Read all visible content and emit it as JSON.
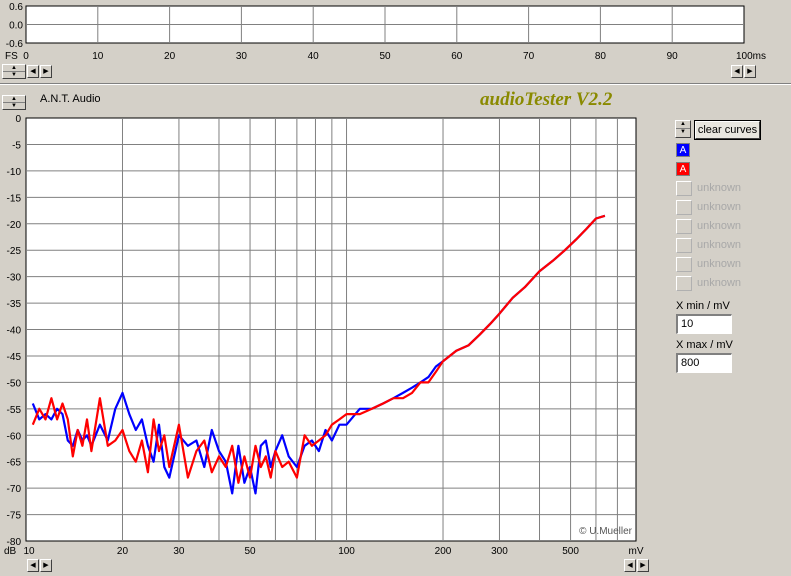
{
  "app": {
    "title": "audioTester V2.2",
    "device": "A.N.T. Audio"
  },
  "top_scope": {
    "y_ticks": [
      "0.6",
      "0.0",
      "-0.6"
    ],
    "x_prefix": "FS",
    "x_ticks": [
      "0",
      "10",
      "20",
      "30",
      "40",
      "50",
      "60",
      "70",
      "80",
      "90",
      "100ms"
    ]
  },
  "controls": {
    "clear_curves": "clear curves",
    "xmin_label": "X min / mV",
    "xmin_value": "10",
    "xmax_label": "X max / mV",
    "xmax_value": "800"
  },
  "legend": [
    {
      "label": "A",
      "color": "#0000ff",
      "active": true
    },
    {
      "label": "A",
      "color": "#ff0000",
      "active": true
    },
    {
      "label": "unknown",
      "active": false
    },
    {
      "label": "unknown",
      "active": false
    },
    {
      "label": "unknown",
      "active": false
    },
    {
      "label": "unknown",
      "active": false
    },
    {
      "label": "unknown",
      "active": false
    },
    {
      "label": "unknown",
      "active": false
    }
  ],
  "colors": {
    "background": "#d4d0c8",
    "plot_bg": "#ffffff",
    "grid": "#808080",
    "brand": "#8a8a00",
    "series_blue": "#0000ff",
    "series_red": "#ff0000"
  },
  "chart_data": {
    "type": "line",
    "xscale": "log",
    "xlim": [
      10,
      800
    ],
    "ylim": [
      -80,
      0
    ],
    "x_unit": "mV",
    "y_unit": "dB",
    "y_ticks": [
      0,
      -5,
      -10,
      -15,
      -20,
      -25,
      -30,
      -35,
      -40,
      -45,
      -50,
      -55,
      -60,
      -65,
      -70,
      -75,
      -80
    ],
    "x_tick_labels": [
      "10",
      "20",
      "30",
      "50",
      "100",
      "200",
      "300",
      "500"
    ],
    "x_tick_values": [
      10,
      20,
      30,
      50,
      100,
      200,
      300,
      500
    ],
    "y_tick_prefix": "dB",
    "copyright": "© U.Mueller",
    "grid": true,
    "series": [
      {
        "color": "#0000ff",
        "x": [
          10.5,
          11,
          11.5,
          12,
          12.5,
          13,
          13.5,
          14,
          14.5,
          15,
          15.5,
          16,
          17,
          18,
          19,
          20,
          21,
          22,
          23,
          24,
          25,
          26,
          27,
          28,
          30,
          32,
          34,
          36,
          38,
          40,
          42,
          44,
          46,
          48,
          50,
          52,
          54,
          56,
          58,
          60,
          63,
          66,
          70,
          74,
          78,
          82,
          86,
          90,
          95,
          100,
          110,
          120,
          130,
          140,
          150,
          160,
          170,
          180,
          190,
          200,
          220,
          240,
          260,
          280,
          300,
          330,
          360,
          400,
          440,
          480,
          520,
          560,
          600,
          640
        ],
        "y": [
          -54,
          -57,
          -56,
          -57,
          -55,
          -56,
          -61,
          -62,
          -59,
          -61,
          -60,
          -62,
          -58,
          -61,
          -55,
          -52,
          -56,
          -59,
          -57,
          -62,
          -65,
          -58,
          -66,
          -68,
          -60,
          -62,
          -61,
          -66,
          -59,
          -63,
          -65,
          -71,
          -62,
          -69,
          -66,
          -71,
          -62,
          -61,
          -66,
          -63,
          -60,
          -64,
          -66,
          -62,
          -61,
          -63,
          -59,
          -61,
          -58,
          -58,
          -55,
          -55,
          -54,
          -53,
          -52,
          -51,
          -50,
          -49,
          -47,
          -46,
          -44,
          -43,
          -41,
          -39,
          -37,
          -34,
          -32,
          -29,
          -27,
          -25,
          -23,
          -21,
          -19,
          -18.5
        ]
      },
      {
        "color": "#ff0000",
        "x": [
          10.5,
          11,
          11.5,
          12,
          12.5,
          13,
          13.5,
          14,
          14.5,
          15,
          15.5,
          16,
          17,
          18,
          19,
          20,
          21,
          22,
          23,
          24,
          25,
          26,
          27,
          28,
          30,
          32,
          34,
          36,
          38,
          40,
          42,
          44,
          46,
          48,
          50,
          52,
          54,
          56,
          58,
          60,
          63,
          66,
          70,
          74,
          78,
          82,
          86,
          90,
          95,
          100,
          110,
          120,
          130,
          140,
          150,
          160,
          170,
          180,
          190,
          200,
          220,
          240,
          260,
          280,
          300,
          330,
          360,
          400,
          440,
          480,
          520,
          560,
          600,
          640
        ],
        "y": [
          -58,
          -55,
          -57,
          -53,
          -57,
          -54,
          -57,
          -64,
          -59,
          -62,
          -57,
          -63,
          -53,
          -62,
          -61,
          -59,
          -63,
          -65,
          -61,
          -67,
          -57,
          -63,
          -60,
          -66,
          -58,
          -68,
          -63,
          -61,
          -67,
          -64,
          -66,
          -62,
          -69,
          -64,
          -68,
          -62,
          -66,
          -64,
          -68,
          -63,
          -66,
          -65,
          -68,
          -60,
          -62,
          -61,
          -60,
          -58,
          -57,
          -56,
          -56,
          -55,
          -54,
          -53,
          -53,
          -52,
          -50,
          -50,
          -48,
          -46,
          -44,
          -43,
          -41,
          -39,
          -37,
          -34,
          -32,
          -29,
          -27,
          -25,
          -23,
          -21,
          -19,
          -18.5
        ]
      }
    ]
  }
}
